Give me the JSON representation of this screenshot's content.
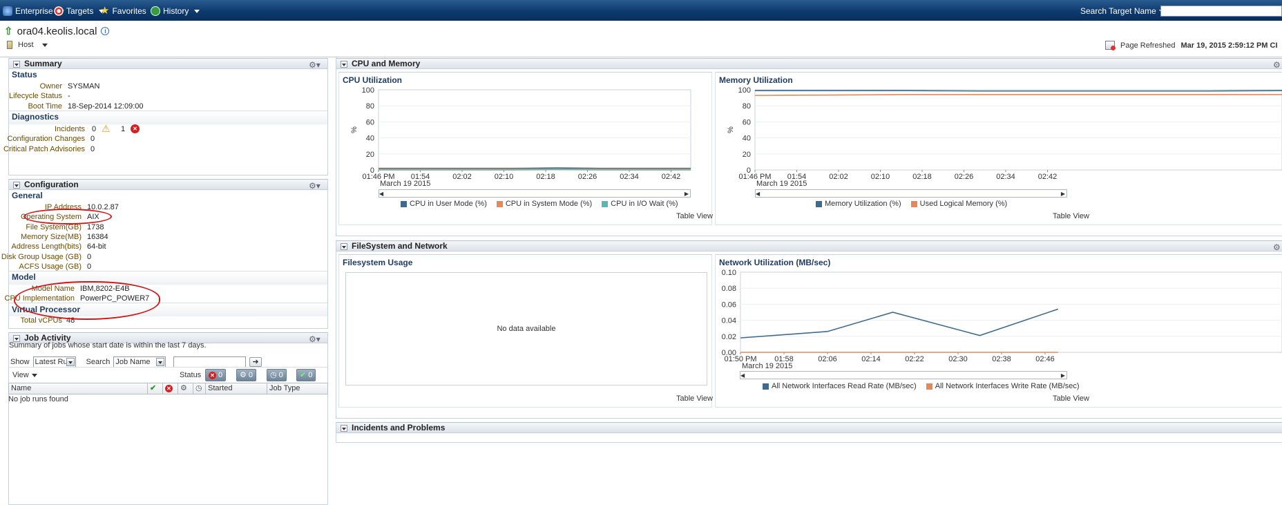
{
  "topbar": {
    "items": [
      {
        "label": "Enterprise",
        "icon": "enterprise-icon"
      },
      {
        "label": "Targets",
        "icon": "targets-icon"
      },
      {
        "label": "Favorites",
        "icon": "star-icon"
      },
      {
        "label": "History",
        "icon": "history-icon"
      }
    ],
    "search_label": "Search Target Name",
    "search_value": ""
  },
  "host": {
    "name": "ora04.keolis.local",
    "menu_label": "Host",
    "refresh_label": "Page Refreshed",
    "refresh_time": "Mar 19, 2015 2:59:12 PM CI"
  },
  "summary": {
    "title": "Summary",
    "status_title": "Status",
    "owner_label": "Owner",
    "owner": "SYSMAN",
    "lifecycle_label": "Lifecycle Status",
    "lifecycle": "-",
    "boot_label": "Boot Time",
    "boot": "18-Sep-2014 12:09:00",
    "diag_title": "Diagnostics",
    "incidents_label": "Incidents",
    "incidents_warn": "0",
    "incidents_crit": "1",
    "config_changes_label": "Configuration Changes",
    "config_changes": "0",
    "cpa_label": "Critical Patch Advisories",
    "cpa": "0"
  },
  "configuration": {
    "title": "Configuration",
    "general_title": "General",
    "ip_label": "IP Address",
    "ip": "10.0.2.87",
    "os_label": "Operating System",
    "os": "AIX",
    "fs_label": "File System(GB)",
    "fs": "1738",
    "mem_label": "Memory Size(MB)",
    "mem": "16384",
    "addr_label": "Address Length(bits)",
    "addr": "64-bit",
    "dg_label": "Disk Group Usage (GB)",
    "dg": "0",
    "acfs_label": "ACFS Usage (GB)",
    "acfs": "0",
    "model_title": "Model",
    "model_name_label": "Model Name",
    "model_name": "IBM,8202-E4B",
    "cpu_impl_label": "CPU Implementation",
    "cpu_impl": "PowerPC_POWER7",
    "vp_title": "Virtual Processor",
    "vcpus_label": "Total vCPUs",
    "vcpus": "48"
  },
  "jobs": {
    "title": "Job Activity",
    "desc": "Summary of jobs whose start date is within the last 7 days.",
    "show_label": "Show",
    "show_value": "Latest Run",
    "search_label": "Search",
    "search_value": "Job Name",
    "view_label": "View",
    "status_label": "Status",
    "status_counts": [
      "0",
      "0",
      "0",
      "0"
    ],
    "columns": [
      "Name",
      "Started",
      "Job Type"
    ],
    "empty": "No job runs found"
  },
  "cpu_memory": {
    "title": "CPU and Memory",
    "table_view": "Table View"
  },
  "fs_network": {
    "title": "FileSystem and Network",
    "table_view": "Table View",
    "fs_title": "Filesystem Usage",
    "fs_empty": "No data available"
  },
  "incidents_panel": {
    "title": "Incidents and Problems"
  },
  "chart_data": [
    {
      "type": "line",
      "title": "CPU Utilization",
      "ylabel": "%",
      "ylim": [
        0,
        100
      ],
      "yticks": [
        "100",
        "80",
        "60",
        "40",
        "20",
        "0"
      ],
      "x": [
        "01:46 PM",
        "01:54",
        "02:02",
        "02:10",
        "02:18",
        "02:26",
        "02:34",
        "02:42"
      ],
      "date_label": "March 19 2015",
      "series": [
        {
          "name": "CPU in User Mode (%)",
          "color": "#3f6a8c",
          "values": [
            2,
            2,
            2,
            2,
            2.5,
            2,
            2,
            2
          ]
        },
        {
          "name": "CPU in System Mode (%)",
          "color": "#e0895a",
          "values": [
            1,
            1,
            1,
            1,
            1,
            1,
            1,
            1
          ]
        },
        {
          "name": "CPU in I/O Wait (%)",
          "color": "#5cb7b2",
          "values": [
            0,
            0,
            0,
            0,
            0.5,
            0,
            0,
            0
          ]
        }
      ]
    },
    {
      "type": "line",
      "title": "Memory Utilization",
      "ylabel": "%",
      "ylim": [
        0,
        100
      ],
      "yticks": [
        "100",
        "80",
        "60",
        "40",
        "20",
        "0"
      ],
      "x": [
        "01:46 PM",
        "01:54",
        "02:02",
        "02:10",
        "02:18",
        "02:26",
        "02:34",
        "02:42"
      ],
      "date_label": "March 19 2015",
      "series": [
        {
          "name": "Memory Utilization (%)",
          "color": "#3f6a8c",
          "values": [
            99,
            99,
            99,
            98.5,
            98.5,
            98.5,
            98.5,
            99
          ]
        },
        {
          "name": "Used Logical Memory (%)",
          "color": "#e0895a",
          "values": [
            93,
            93.5,
            94,
            94,
            94,
            94,
            94,
            94
          ]
        }
      ]
    },
    {
      "type": "line",
      "title": "Network Utilization (MB/sec)",
      "ylim": [
        0,
        0.1
      ],
      "yticks": [
        "0.10",
        "0.08",
        "0.06",
        "0.04",
        "0.02",
        "0.00"
      ],
      "x": [
        "01:50 PM",
        "01:58",
        "02:06",
        "02:14",
        "02:22",
        "02:30",
        "02:38",
        "02:46"
      ],
      "date_label": "March 19 2015",
      "series": [
        {
          "name": "All Network Interfaces Read Rate (MB/sec)",
          "color": "#3f6a8c",
          "points": [
            [
              0,
              0.018
            ],
            [
              2,
              0.026
            ],
            [
              3.5,
              0.05
            ],
            [
              5.5,
              0.021
            ],
            [
              7.3,
              0.054
            ]
          ]
        },
        {
          "name": "All Network Interfaces Write Rate (MB/sec)",
          "color": "#e0895a",
          "points": [
            [
              0,
              0.0
            ],
            [
              7.3,
              0.0
            ]
          ]
        }
      ]
    }
  ],
  "colors": {
    "topbar": "#0d3a6e",
    "heading": "#1f3a5f",
    "label": "#6b4b00",
    "annotation": "#d01818"
  }
}
